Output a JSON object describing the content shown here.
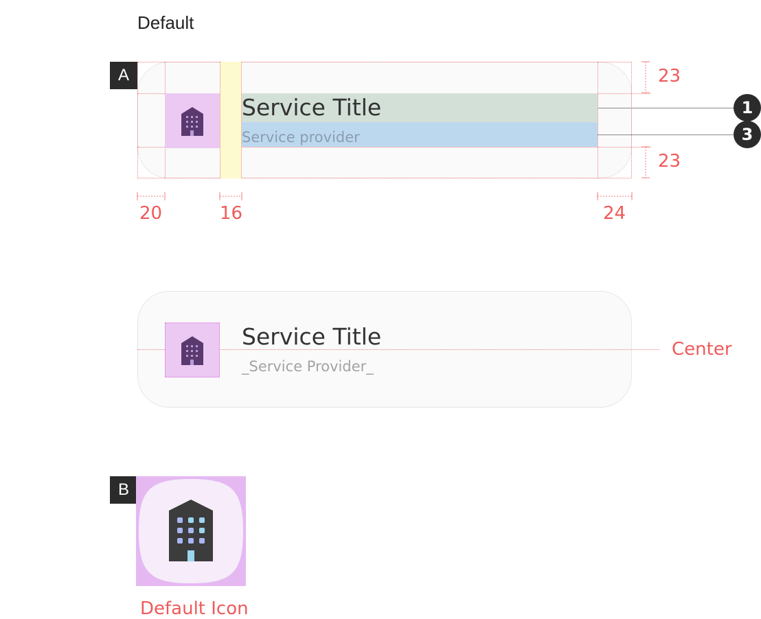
{
  "heading": "Default",
  "section_a": {
    "label": "A",
    "title": "Service Title",
    "subtitle": "Service provider",
    "callouts": [
      "1",
      "3"
    ],
    "spacing": {
      "top": "23",
      "bottom": "23",
      "left": "20",
      "gap": "16",
      "right": "24"
    }
  },
  "section_center": {
    "title": "Service Title",
    "subtitle": "_Service Provider_",
    "center_label": "Center"
  },
  "section_b": {
    "label": "B",
    "caption": "Default Icon"
  },
  "colors": {
    "annotation": "#f05a5a",
    "icon_bg": "#ecc9f3",
    "gap_highlight": "#fdfad0",
    "title_highlight": "#d3e0d8",
    "subtitle_highlight": "#bcd8ef",
    "building": "#5a3a6e"
  },
  "icons": {
    "list_icon": "building-icon",
    "default_icon": "building-icon"
  }
}
